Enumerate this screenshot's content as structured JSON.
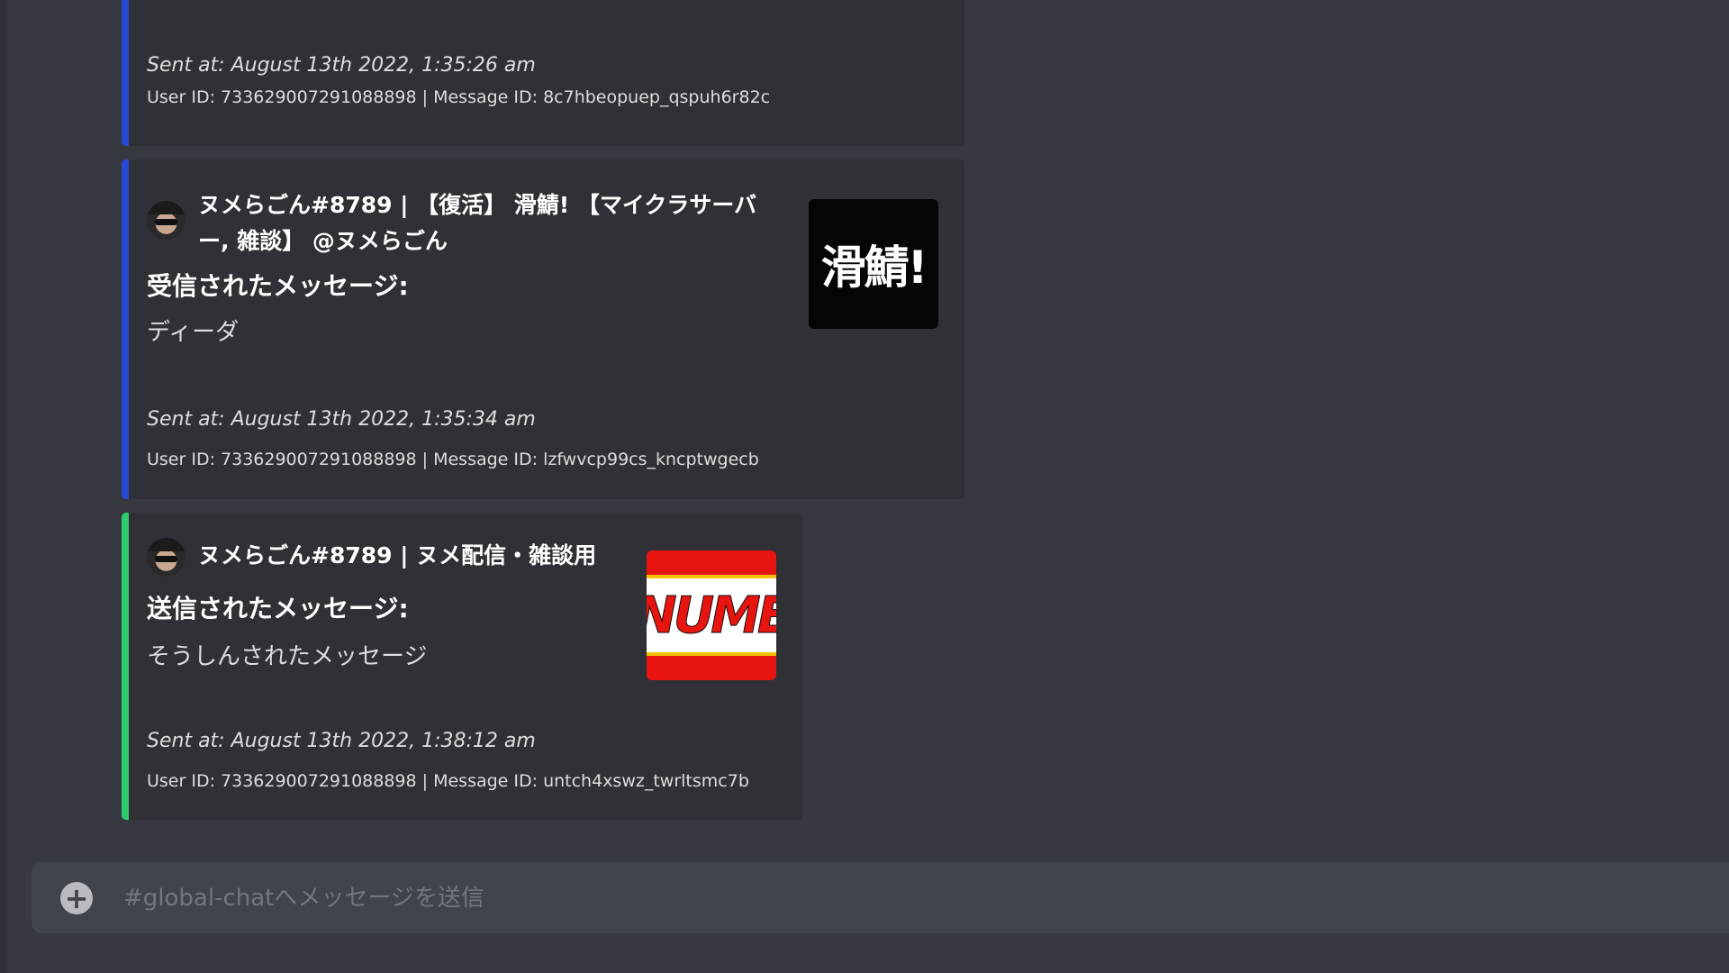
{
  "colors": {
    "background": "#36393f",
    "embed_background": "#2f3136",
    "received_accent": "#2749d6",
    "sent_accent": "#2ecc71",
    "input_background": "#40444b"
  },
  "messages": [
    {
      "sent_at": "Sent at: August 13th 2022, 1:35:26 am",
      "footer": "User ID: 733629007291088898 | Message ID: 8c7hbeopuep_qspuh6r82c"
    },
    {
      "author_line1": "ヌメらごん#8789 | 【復活】 滑鯖! 【マイクラサーバ",
      "author_line2": "ー, 雑談】 @ヌメらごん",
      "field_title": "受信されたメッセージ:",
      "field_value": "ディーダ",
      "thumbnail_text": "滑鯖!",
      "sent_at": "Sent at: August 13th 2022, 1:35:34 am",
      "footer": "User ID: 733629007291088898 | Message ID: lzfwvcp99cs_kncptwgecb"
    },
    {
      "author_line1": "ヌメらごん#8789 | ヌメ配信・雑談用",
      "field_title": "送信されたメッセージ:",
      "field_value": "そうしんされたメッセージ",
      "thumbnail_text": "NUME",
      "sent_at": "Sent at: August 13th 2022, 1:38:12 am",
      "footer": "User ID: 733629007291088898 | Message ID: untch4xswz_twrltsmc7b"
    }
  ],
  "chat_input": {
    "placeholder": "#global-chatへメッセージを送信",
    "value": "",
    "add_icon": "plus-circle-icon"
  }
}
